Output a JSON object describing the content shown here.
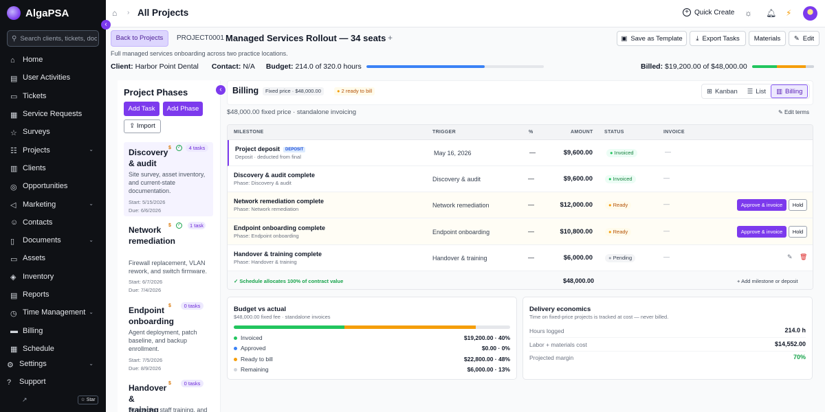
{
  "app": {
    "name": "AlgaPSA"
  },
  "sidebar": {
    "search_placeholder": "Search clients, tickets, doc",
    "items": [
      {
        "label": "Home",
        "icon": "home-icon"
      },
      {
        "label": "User Activities",
        "icon": "chart-icon"
      },
      {
        "label": "Tickets",
        "icon": "ticket-icon"
      },
      {
        "label": "Service Requests",
        "icon": "request-icon"
      },
      {
        "label": "Surveys",
        "icon": "star-icon"
      },
      {
        "label": "Projects",
        "icon": "projects-icon",
        "expandable": true
      },
      {
        "label": "Clients",
        "icon": "building-icon"
      },
      {
        "label": "Opportunities",
        "icon": "target-icon"
      },
      {
        "label": "Marketing",
        "icon": "megaphone-icon",
        "expandable": true
      },
      {
        "label": "Contacts",
        "icon": "contacts-icon"
      },
      {
        "label": "Documents",
        "icon": "document-icon",
        "expandable": true
      },
      {
        "label": "Assets",
        "icon": "monitor-icon"
      },
      {
        "label": "Inventory",
        "icon": "box-icon"
      },
      {
        "label": "Reports",
        "icon": "report-icon"
      },
      {
        "label": "Time Management",
        "icon": "clock-icon",
        "expandable": true
      },
      {
        "label": "Billing",
        "icon": "card-icon"
      },
      {
        "label": "Schedule",
        "icon": "calendar-icon"
      }
    ],
    "settings_label": "Settings",
    "support_label": "Support",
    "star_label": "Star"
  },
  "topbar": {
    "breadcrumb_title": "All Projects",
    "quick_create_label": "Quick Create"
  },
  "project": {
    "back_label": "Back to Projects",
    "id": "PROJECT0001",
    "title": "Managed Services Rollout — 34 seats",
    "description": "Full managed services onboarding across two practice locations.",
    "client_label": "Client:",
    "client": "Harbor Point Dental",
    "contact_label": "Contact:",
    "contact": "N/A",
    "budget_label": "Budget:",
    "budget": "214.0 of 320.0 hours",
    "budget_fraction": 0.669,
    "billed_label": "Billed:",
    "billed": "$19,200.00 of $48,000.00",
    "buttons": {
      "save_template": "Save as Template",
      "export_tasks": "Export Tasks",
      "materials": "Materials",
      "edit": "Edit"
    }
  },
  "phases_panel": {
    "title": "Project Phases",
    "add_task": "Add Task",
    "add_phase": "Add Phase",
    "import": "Import",
    "phases": [
      {
        "name": "Discovery & audit",
        "tasks": "4 tasks",
        "desc": "Site survey, asset inventory, and current-state documentation.",
        "start": "Start: 5/15/2026",
        "due": "Due: 6/6/2026"
      },
      {
        "name": "Network remediation",
        "tasks": "1 task",
        "desc": "Firewall replacement, VLAN rework, and switch firmware.",
        "start": "Start: 6/7/2026",
        "due": "Due: 7/4/2026"
      },
      {
        "name": "Endpoint onboarding",
        "tasks": "0 tasks",
        "desc": "Agent deployment, patch baseline, and backup enrollment.",
        "start": "Start: 7/5/2026",
        "due": "Due: 8/9/2026"
      },
      {
        "name": "Handover & training",
        "tasks": "0 tasks",
        "desc": "Runbooks, staff training, and",
        "start": "",
        "due": ""
      }
    ]
  },
  "billing": {
    "title": "Billing",
    "chip_fixed": "Fixed price · $48,000.00",
    "chip_ready": "2 ready to bill",
    "views": [
      "Kanban",
      "List",
      "Billing"
    ],
    "fixed_line": "$48,000.00 fixed price · standalone invoicing",
    "edit_terms": "Edit terms",
    "columns": [
      "MILESTONE",
      "TRIGGER",
      "%",
      "AMOUNT",
      "STATUS",
      "INVOICE"
    ],
    "rows": [
      {
        "name": "Project deposit",
        "badge": "DEPOSIT",
        "sub": "Deposit · deducted from final",
        "trigger": "May 16, 2026",
        "pct": "—",
        "amount": "$9,600.00",
        "status": "Invoiced",
        "invoice": "—"
      },
      {
        "name": "Discovery & audit complete",
        "sub": "Phase: Discovery & audit",
        "trigger": "Discovery & audit",
        "pct": "—",
        "amount": "$9,600.00",
        "status": "Invoiced",
        "invoice": "—"
      },
      {
        "name": "Network remediation complete",
        "sub": "Phase: Network remediation",
        "trigger": "Network remediation",
        "pct": "—",
        "amount": "$12,000.00",
        "status": "Ready",
        "invoice": "—"
      },
      {
        "name": "Endpoint onboarding complete",
        "sub": "Phase: Endpoint onboarding",
        "trigger": "Endpoint onboarding",
        "pct": "—",
        "amount": "$10,800.00",
        "status": "Ready",
        "invoice": "—"
      },
      {
        "name": "Handover & training complete",
        "sub": "Phase: Handover & training",
        "trigger": "Handover & training",
        "pct": "—",
        "amount": "$6,000.00",
        "status": "Pending",
        "invoice": "—"
      }
    ],
    "approve_label": "Approve & invoice",
    "hold_label": "Hold",
    "allocation": "✓ Schedule allocates 100% of contract value",
    "total": "$48,000.00",
    "add_milestone": "Add milestone or deposit"
  },
  "budget_card": {
    "title": "Budget vs actual",
    "subtitle": "$48,000.00 fixed fee · standalone invoices",
    "segments": [
      {
        "label": "Invoiced",
        "value": "$19,200.00 · 40%",
        "fraction": 0.4,
        "color": "#22c55e"
      },
      {
        "label": "Approved",
        "value": "$0.00 · 0%",
        "fraction": 0.0,
        "color": "#3b82f6"
      },
      {
        "label": "Ready to bill",
        "value": "$22,800.00 · 48%",
        "fraction": 0.475,
        "color": "#f59e0b"
      },
      {
        "label": "Remaining",
        "value": "$6,000.00 · 13%",
        "fraction": 0.125,
        "color": "#d1d5db"
      }
    ]
  },
  "economics_card": {
    "title": "Delivery economics",
    "subtitle": "Time on fixed-price projects is tracked at cost — never billed.",
    "rows": [
      {
        "label": "Hours logged",
        "value": "214.0 h"
      },
      {
        "label": "Labor + materials cost",
        "value": "$14,552.00"
      },
      {
        "label": "Projected margin",
        "value": "70%"
      }
    ]
  }
}
